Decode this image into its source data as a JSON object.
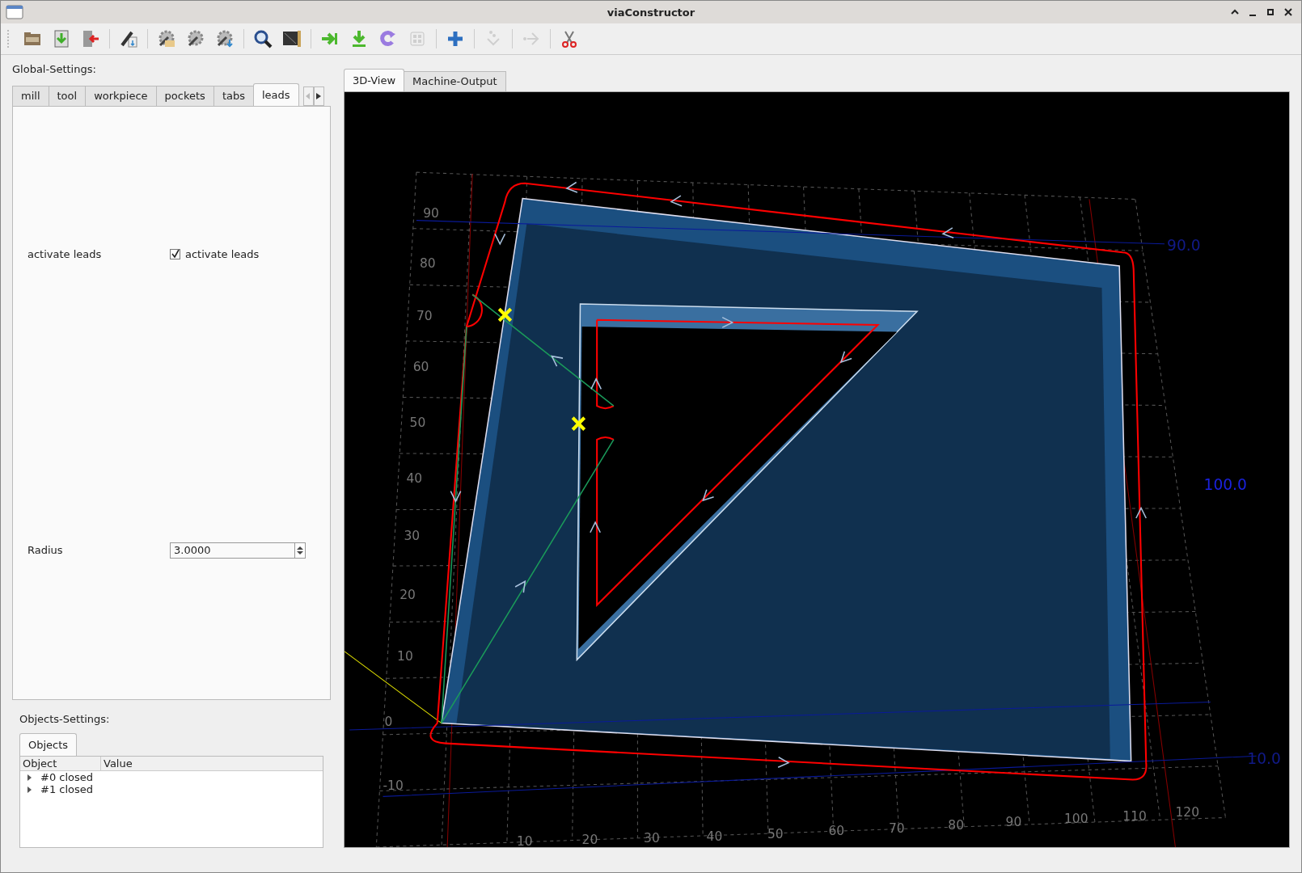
{
  "window": {
    "title": "viaConstructor"
  },
  "toolbar": [
    {
      "kind": "open",
      "disabled": false
    },
    {
      "kind": "save",
      "disabled": false
    },
    {
      "kind": "exit",
      "disabled": false
    },
    {
      "kind": "sep"
    },
    {
      "kind": "edit",
      "disabled": false
    },
    {
      "kind": "sep"
    },
    {
      "kind": "gear-open",
      "disabled": false
    },
    {
      "kind": "gear",
      "disabled": false
    },
    {
      "kind": "gear-save",
      "disabled": false
    },
    {
      "kind": "sep"
    },
    {
      "kind": "search",
      "disabled": false
    },
    {
      "kind": "monitor",
      "disabled": false
    },
    {
      "kind": "sep"
    },
    {
      "kind": "next",
      "disabled": false
    },
    {
      "kind": "download",
      "disabled": false
    },
    {
      "kind": "redo",
      "disabled": false
    },
    {
      "kind": "grid",
      "disabled": true
    },
    {
      "kind": "sep"
    },
    {
      "kind": "add",
      "disabled": false
    },
    {
      "kind": "sep"
    },
    {
      "kind": "dots",
      "disabled": true
    },
    {
      "kind": "sep"
    },
    {
      "kind": "forward",
      "disabled": true
    },
    {
      "kind": "sep"
    },
    {
      "kind": "cut",
      "disabled": false
    }
  ],
  "global_settings": {
    "label": "Global-Settings:",
    "tabs": [
      {
        "label": "mill",
        "selected": false
      },
      {
        "label": "tool",
        "selected": false
      },
      {
        "label": "workpiece",
        "selected": false
      },
      {
        "label": "pockets",
        "selected": false
      },
      {
        "label": "tabs",
        "selected": false
      },
      {
        "label": "leads",
        "selected": true
      }
    ],
    "fields": [
      {
        "kind": "checkbox",
        "label": "activate leads",
        "text": "activate leads",
        "checked": true
      },
      {
        "kind": "spinbox",
        "label": "Radius",
        "value": "3.0000"
      }
    ]
  },
  "objects_settings": {
    "label": "Objects-Settings:",
    "tabs": [
      {
        "label": "Objects",
        "selected": true
      }
    ],
    "columns": [
      "Object",
      "Value"
    ],
    "rows": [
      {
        "label": "#0 closed",
        "expanded": false
      },
      {
        "label": "#1 closed",
        "expanded": false
      }
    ]
  },
  "view_tabs": [
    {
      "label": "3D-View",
      "selected": true
    },
    {
      "label": "Machine-Output",
      "selected": false
    }
  ],
  "view": {
    "y_labels": [
      "90",
      "80",
      "70",
      "60",
      "50",
      "40",
      "30",
      "20",
      "10",
      "0",
      "-10"
    ],
    "x_labels": [
      "10",
      "20",
      "30",
      "40",
      "50",
      "60",
      "70",
      "80",
      "90",
      "100",
      "110",
      "120"
    ],
    "axis_values": [
      "90.0",
      "100.0",
      "10.0"
    ]
  }
}
